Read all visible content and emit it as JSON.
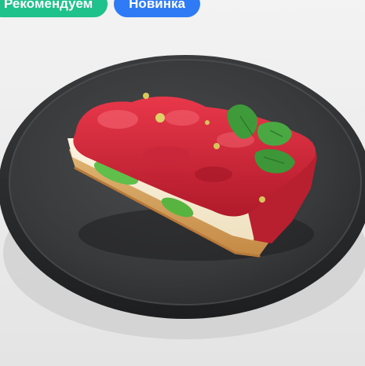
{
  "badges": {
    "recommended": {
      "label": "Рекомендуем",
      "color": "#1fc28b"
    },
    "new": {
      "label": "Новинка",
      "color": "#2f7bf5"
    }
  },
  "product_image": {
    "depicts": "strawberry-tart-slice-on-black-plate"
  }
}
